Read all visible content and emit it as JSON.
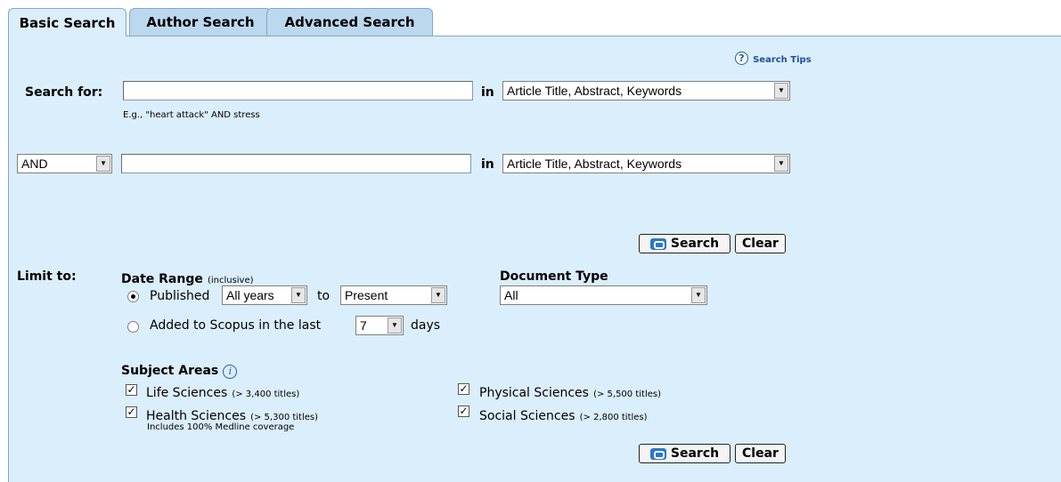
{
  "tabs": [
    {
      "label": "Basic Search"
    },
    {
      "label": "Author Search"
    },
    {
      "label": "Advanced Search"
    }
  ],
  "search_tips": "Search Tips",
  "search_for_label": "Search for:",
  "row1": {
    "value": "",
    "in_label": "in",
    "field_select": "Article Title, Abstract, Keywords"
  },
  "example_hint": "E.g., \"heart attack\" AND stress",
  "row2": {
    "operator": "AND",
    "value": "",
    "in_label": "in",
    "field_select": "Article Title, Abstract, Keywords"
  },
  "buttons": {
    "search": "Search",
    "clear": "Clear"
  },
  "limit_to_label": "Limit to:",
  "date_range": {
    "title": "Date Range",
    "qualifier": "(inclusive)",
    "published_label": "Published",
    "from": "All years",
    "to_label": "to",
    "to": "Present",
    "added_label": "Added to Scopus in the last",
    "days_value": "7",
    "days_label": "days"
  },
  "document_type": {
    "title": "Document Type",
    "value": "All"
  },
  "subject_areas": {
    "title": "Subject Areas",
    "items": [
      {
        "label": "Life Sciences",
        "count": "(> 3,400 titles)",
        "checked": true
      },
      {
        "label": "Physical Sciences",
        "count": "(> 5,500 titles)",
        "checked": true
      },
      {
        "label": "Health Sciences",
        "count": "(> 5,300 titles)",
        "checked": true,
        "note": "Includes 100% Medline coverage"
      },
      {
        "label": "Social Sciences",
        "count": "(> 2,800 titles)",
        "checked": true
      }
    ]
  }
}
